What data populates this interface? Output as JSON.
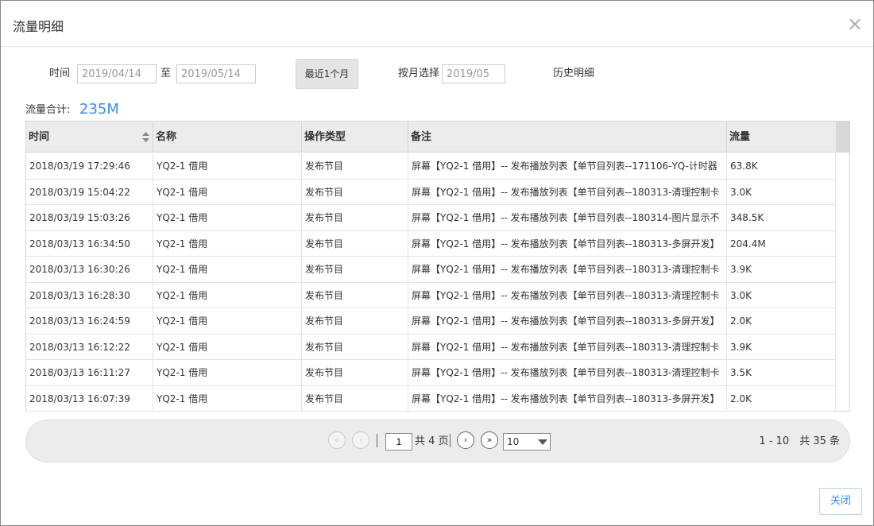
{
  "dialog": {
    "title": "流量明细",
    "close_icon": "close-icon"
  },
  "filter": {
    "time_label": "时间",
    "start_date": "2019/04/14",
    "range_sep": "至",
    "end_date": "2019/05/14",
    "recent_button": "最近1个月",
    "month_label": "按月选择",
    "month_value": "2019/05",
    "history_link": "历史明细"
  },
  "summary": {
    "label": "流量合计:",
    "value": "235M"
  },
  "table": {
    "columns": [
      "时间",
      "名称",
      "操作类型",
      "备注",
      "流量"
    ],
    "rows": [
      [
        "2018/03/19 17:29:46",
        "YQ2-1 借用",
        "发布节目",
        "屏幕【YQ2-1 借用】-- 发布播放列表【单节目列表--171106-YQ-计时器",
        "63.8K"
      ],
      [
        "2018/03/19 15:04:22",
        "YQ2-1 借用",
        "发布节目",
        "屏幕【YQ2-1 借用】-- 发布播放列表【单节目列表--180313-清理控制卡",
        "3.0K"
      ],
      [
        "2018/03/19 15:03:26",
        "YQ2-1 借用",
        "发布节目",
        "屏幕【YQ2-1 借用】-- 发布播放列表【单节目列表--180314-图片显示不",
        "348.5K"
      ],
      [
        "2018/03/13 16:34:50",
        "YQ2-1 借用",
        "发布节目",
        "屏幕【YQ2-1 借用】-- 发布播放列表【单节目列表--180313-多屏开发】",
        "204.4M"
      ],
      [
        "2018/03/13 16:30:26",
        "YQ2-1 借用",
        "发布节目",
        "屏幕【YQ2-1 借用】-- 发布播放列表【单节目列表--180313-清理控制卡",
        "3.9K"
      ],
      [
        "2018/03/13 16:28:30",
        "YQ2-1 借用",
        "发布节目",
        "屏幕【YQ2-1 借用】-- 发布播放列表【单节目列表--180313-清理控制卡",
        "3.0K"
      ],
      [
        "2018/03/13 16:24:59",
        "YQ2-1 借用",
        "发布节目",
        "屏幕【YQ2-1 借用】-- 发布播放列表【单节目列表--180313-多屏开发】",
        "2.0K"
      ],
      [
        "2018/03/13 16:12:22",
        "YQ2-1 借用",
        "发布节目",
        "屏幕【YQ2-1 借用】-- 发布播放列表【单节目列表--180313-清理控制卡",
        "3.9K"
      ],
      [
        "2018/03/13 16:11:27",
        "YQ2-1 借用",
        "发布节目",
        "屏幕【YQ2-1 借用】-- 发布播放列表【单节目列表--180313-清理控制卡",
        "3.5K"
      ],
      [
        "2018/03/13 16:07:39",
        "YQ2-1 借用",
        "发布节目",
        "屏幕【YQ2-1 借用】-- 发布播放列表【单节目列表--180313-多屏开发】",
        "2.0K"
      ]
    ]
  },
  "pager": {
    "current_page": "1",
    "total_pages": "共 4 页",
    "page_size": "10",
    "range": "1 - 10　共 35 条",
    "icons": {
      "first": "first-page-icon",
      "prev": "prev-page-icon",
      "next": "next-page-icon",
      "last": "last-page-icon"
    }
  },
  "footer": {
    "close_button": "关闭"
  },
  "colors": {
    "accent": "#3a8ee6",
    "header_bg": "#ececec",
    "button_bg": "#e4e4e4"
  }
}
